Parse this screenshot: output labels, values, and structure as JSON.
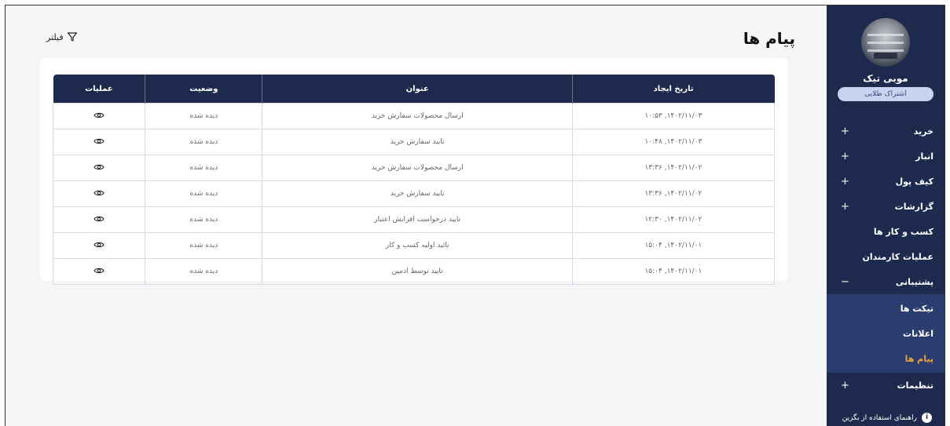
{
  "page": {
    "title": "پیام ها",
    "filter_label": "فیلتر"
  },
  "sidebar": {
    "store_name": "موبی تیک",
    "plan": "اشتراک طلایی",
    "items": [
      {
        "label": "خرید",
        "sign": "+"
      },
      {
        "label": "انبار",
        "sign": "+"
      },
      {
        "label": "کیف پول",
        "sign": "+"
      },
      {
        "label": "گزارشات",
        "sign": "+"
      },
      {
        "label": "کسب و کار ها",
        "sign": ""
      },
      {
        "label": "عملیات کارمندان",
        "sign": ""
      },
      {
        "label": "پشتیبانی",
        "sign": "−"
      }
    ],
    "support_sub": [
      {
        "label": "تیکت ها"
      },
      {
        "label": "اعلانات"
      },
      {
        "label": "پیام ها",
        "active": true
      }
    ],
    "settings": {
      "label": "تنظیمات",
      "sign": "+"
    },
    "help_label": "راهنمای استفاده از بگزین"
  },
  "table": {
    "headers": [
      "تاریخ ایجاد",
      "عنوان",
      "وضعیت",
      "عملیات"
    ],
    "rows": [
      [
        "۱۴۰۲/۱۱/۰۳, ۱۰:۵۳",
        "ارسال محصولات سفارش خرید",
        "دیده شده"
      ],
      [
        "۱۴۰۲/۱۱/۰۳, ۱۰:۴۸",
        "تایید سفارش خرید",
        "دیده شده"
      ],
      [
        "۱۴۰۲/۱۱/۰۲, ۱۳:۳۶",
        "ارسال محصولات سفارش خرید",
        "دیده شده"
      ],
      [
        "۱۴۰۲/۱۱/۰۲, ۱۳:۳۶",
        "تایید سفارش خرید",
        "دیده شده"
      ],
      [
        "۱۴۰۲/۱۱/۰۲, ۱۲:۳۰",
        "تایید درخواست افزایش اعتبار",
        "دیده شده"
      ],
      [
        "۱۴۰۲/۱۱/۰۱, ۱۵:۰۴",
        "تائید اولیه کسب و کار",
        "دیده شده"
      ],
      [
        "۱۴۰۲/۱۱/۰۱, ۱۵:۰۴",
        "تایید توسط ادمین",
        "دیده شده"
      ]
    ]
  },
  "colors": {
    "sidebar": "#1d2a4d",
    "submenu": "#2a3d6e",
    "accent": "#f0a23a"
  },
  "icons": {
    "view": "eye-icon",
    "filter": "funnel-icon",
    "info": "info-icon"
  }
}
